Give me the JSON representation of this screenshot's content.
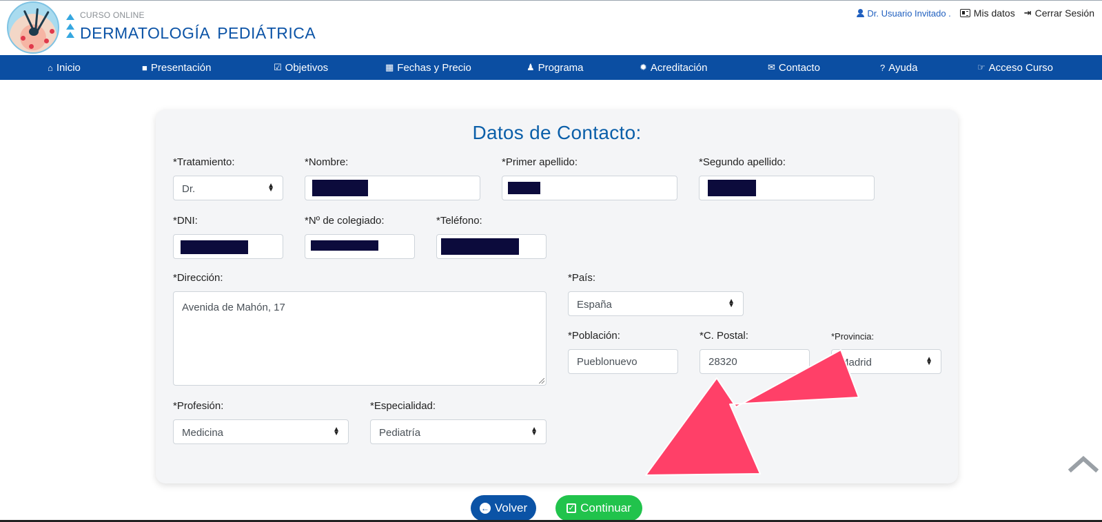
{
  "header": {
    "course_small": "CURSO ONLINE",
    "course_title_1": "DERMATOLOGÍA",
    "course_title_2": "PEDIÁTRICA",
    "user_name": "Dr. Usuario Invitado .",
    "my_data": "Mis datos",
    "logout": "Cerrar Sesión"
  },
  "nav": {
    "items": [
      {
        "label": "Inicio",
        "icon": "home-icon"
      },
      {
        "label": "Presentación",
        "icon": "video-icon"
      },
      {
        "label": "Objetivos",
        "icon": "check-square-icon"
      },
      {
        "label": "Fechas y Precio",
        "icon": "calendar-icon"
      },
      {
        "label": "Programa",
        "icon": "user-tie-icon"
      },
      {
        "label": "Acreditación",
        "icon": "badge-icon"
      },
      {
        "label": "Contacto",
        "icon": "envelope-icon"
      },
      {
        "label": "Ayuda",
        "icon": "question-circle-icon"
      },
      {
        "label": "Acceso Curso",
        "icon": "hand-pointer-icon"
      }
    ]
  },
  "form": {
    "title": "Datos de Contacto:",
    "tratamiento": {
      "label": "*Tratamiento:",
      "value": "Dr."
    },
    "nombre": {
      "label": "*Nombre:"
    },
    "primer_apellido": {
      "label": "*Primer apellido:"
    },
    "segundo_apellido": {
      "label": "*Segundo apellido:"
    },
    "dni": {
      "label": "*DNI:"
    },
    "colegiado": {
      "label": "*Nº de colegiado:"
    },
    "telefono": {
      "label": "*Teléfono:"
    },
    "direccion": {
      "label": "*Dirección:",
      "value": "Avenida de Mahón, 17"
    },
    "pais": {
      "label": "*País:",
      "value": "España"
    },
    "poblacion": {
      "label": "*Población:",
      "value": "Pueblonuevo"
    },
    "cpostal": {
      "label": "*C. Postal:",
      "value": "28320"
    },
    "provincia": {
      "label": "*Provincia:",
      "value": "Madrid"
    },
    "profesion": {
      "label": "*Profesión:",
      "value": "Medicina"
    },
    "especialidad": {
      "label": "*Especialidad:",
      "value": "Pediatría"
    }
  },
  "buttons": {
    "volver": "Volver",
    "continuar": "Continuar"
  },
  "colors": {
    "brand_blue": "#0b4ea2",
    "title_blue": "#0b5fa9",
    "continue_green": "#21c34c",
    "annotation_pink": "#ff4068"
  }
}
